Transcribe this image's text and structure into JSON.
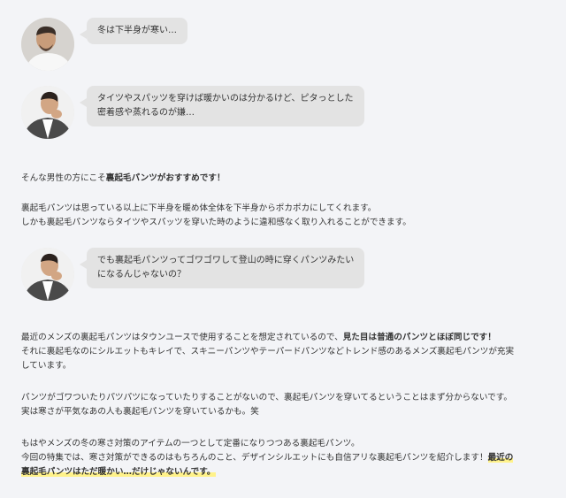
{
  "chat1": {
    "text": "冬は下半身が寒い…"
  },
  "chat2": {
    "line1": "タイツやスパッツを穿けば暖かいのは分かるけど、ピタっとした",
    "line2": "密着感や蒸れるのが嫌…"
  },
  "para1": {
    "before": "そんな男性の方にこそ",
    "bold": "裏起毛パンツがおすすめです！"
  },
  "para2": {
    "line1": "裏起毛パンツは思っている以上に下半身を暖め体全体を下半身からポカポカにしてくれます。",
    "line2": "しかも裏起毛パンツならタイツやスパッツを穿いた時のように違和感なく取り入れることができます。"
  },
  "chat3": {
    "line1": "でも裏起毛パンツってゴワゴワして登山の時に穿くパンツみたい",
    "line2": "になるんじゃないの？"
  },
  "para3": {
    "l1_before": "最近のメンズの裏起毛パンツはタウンユースで使用することを想定されているので、",
    "l1_bold": "見た目は普通のパンツとほぼ同じです！",
    "l2": "それに裏起毛なのにシルエットもキレイで、スキニーパンツやテーパードパンツなどトレンド感のあるメンズ裏起毛パンツが充実",
    "l3": "しています。"
  },
  "para4": {
    "line1": "パンツがゴワついたりパツパツになっていたりすることがないので、裏起毛パンツを穿いてるということはまず分からないです。",
    "line2": "実は寒さが平気なあの人も裏起毛パンツを穿いているかも。笑"
  },
  "para5": {
    "line1": "もはやメンズの冬の寒さ対策のアイテムの一つとして定番になりつつある裏起毛パンツ。",
    "l2_before": "今回の特集では、寒さ対策ができるのはもちろんのこと、デザインシルエットにも自信アリな裏起毛パンツを紹介します！",
    "l2_hl": "最近の",
    "l3_hl": "裏起毛パンツはただ暖かい…だけじゃないんです。"
  }
}
